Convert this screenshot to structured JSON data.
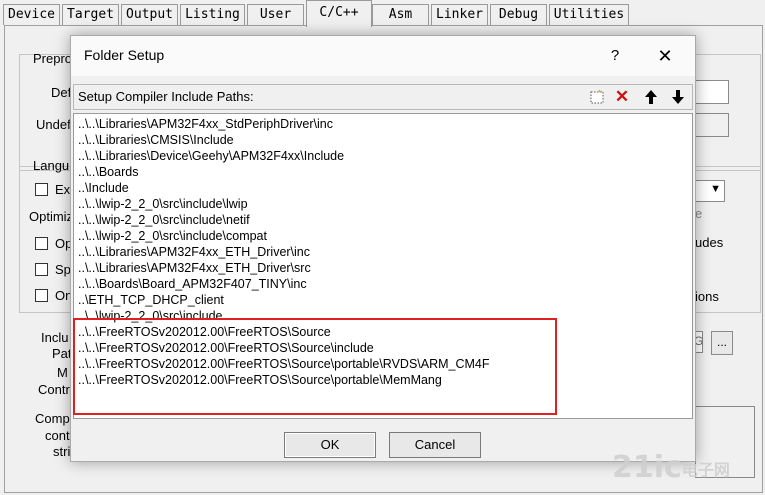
{
  "tabs": [
    "Device",
    "Target",
    "Output",
    "Listing",
    "User",
    "C/C++",
    "Asm",
    "Linker",
    "Debug",
    "Utilities"
  ],
  "active_tab": "C/C++",
  "background": {
    "preprocessor_label": "Prepro",
    "define_label": "Def",
    "undefine_label": "Undef",
    "language_label": "Langu",
    "ex_label": "Ex",
    "optimize_label": "Optimiz",
    "op_label": "Op",
    "sp_label": "Sp",
    "on_label": "On",
    "include_label": "Inclu",
    "paths_label": "Pat",
    "misc_label": "M",
    "controls_label": "Contr",
    "compiler_label": "Comp",
    "control_label": "cont",
    "string_label": "stri",
    "right_includes": "udes",
    "right_options": "ions",
    "right_e": "e",
    "browse_btn": "...",
    "side_g": "G"
  },
  "dialog": {
    "title": "Folder Setup",
    "help": "?",
    "close": "✕",
    "subheading": "Setup Compiler Include Paths:",
    "toolbar": {
      "new": "⬚",
      "delete": "✕",
      "up": "🡑",
      "down": "🡓"
    },
    "paths": [
      "..\\..\\Libraries\\APM32F4xx_StdPeriphDriver\\inc",
      "..\\..\\Libraries\\CMSIS\\Include",
      "..\\..\\Libraries\\Device\\Geehy\\APM32F4xx\\Include",
      "..\\..\\Boards",
      "..\\Include",
      "..\\..\\lwip-2_2_0\\src\\include\\lwip",
      "..\\..\\lwip-2_2_0\\src\\include\\netif",
      "..\\..\\lwip-2_2_0\\src\\include\\compat",
      "..\\..\\Libraries\\APM32F4xx_ETH_Driver\\inc",
      "..\\..\\Libraries\\APM32F4xx_ETH_Driver\\src",
      "..\\..\\Boards\\Board_APM32F407_TINY\\inc",
      "..\\ETH_TCP_DHCP_client",
      "..\\..\\lwip-2_2_0\\src\\include",
      "..\\..\\FreeRTOSv202012.00\\FreeRTOS\\Source",
      "..\\..\\FreeRTOSv202012.00\\FreeRTOS\\Source\\include",
      "..\\..\\FreeRTOSv202012.00\\FreeRTOS\\Source\\portable\\RVDS\\ARM_CM4F",
      "..\\..\\FreeRTOSv202012.00\\FreeRTOS\\Source\\portable\\MemMang"
    ],
    "ok": "OK",
    "cancel": "Cancel"
  },
  "highlight_color": "#e02020",
  "watermark": {
    "main": "21ic",
    "sub": "电子网"
  }
}
